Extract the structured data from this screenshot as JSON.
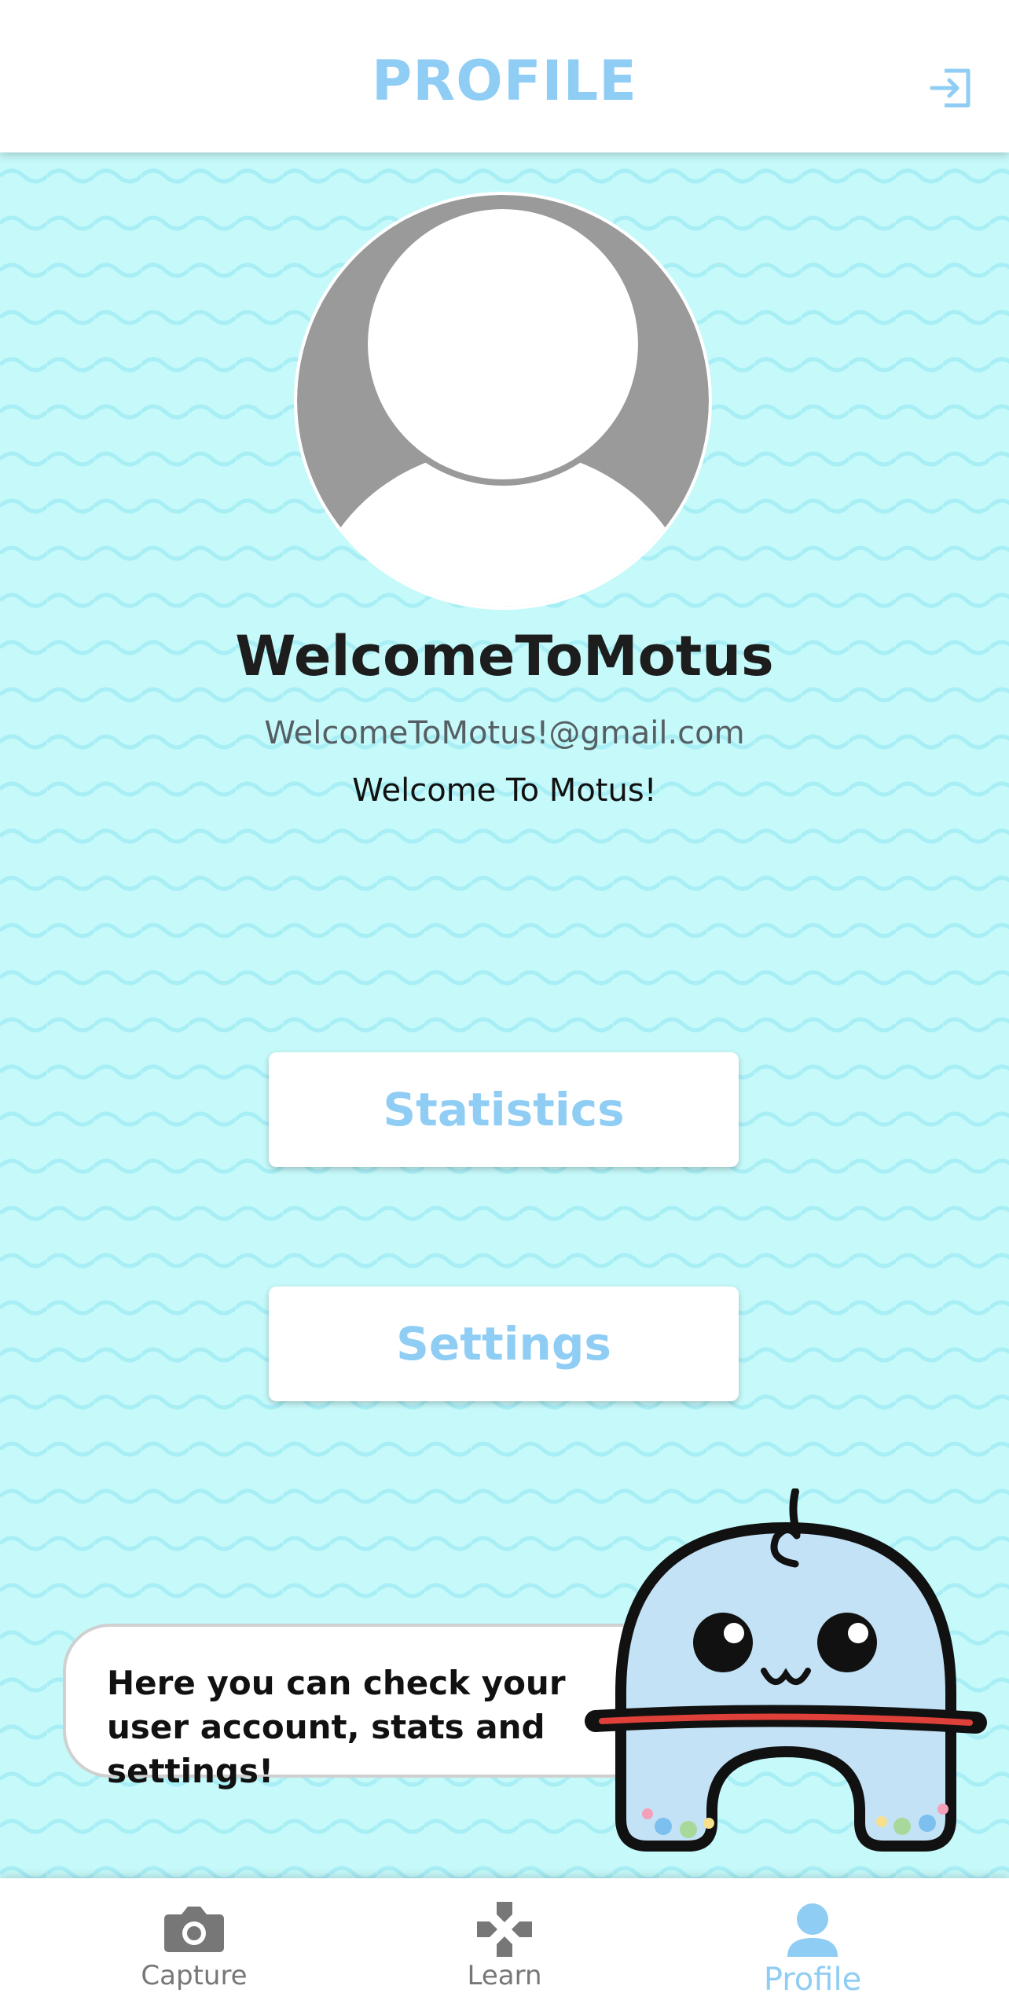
{
  "header": {
    "title": "PROFILE",
    "logout_icon": "logout-icon"
  },
  "profile": {
    "avatar_icon": "default-avatar-icon",
    "username": "WelcomeToMotus",
    "email": "WelcomeToMotus!@gmail.com",
    "bio": "Welcome To Motus!"
  },
  "actions": {
    "statistics_label": "Statistics",
    "settings_label": "Settings"
  },
  "mascot": {
    "message": "Here you can check your user account, stats and settings!"
  },
  "tabs": [
    {
      "label": "Capture",
      "icon": "camera-icon",
      "active": false
    },
    {
      "label": "Learn",
      "icon": "gamepad-icon",
      "active": false
    },
    {
      "label": "Profile",
      "icon": "person-icon",
      "active": true
    }
  ],
  "colors": {
    "accent": "#8fcdf4",
    "background": "#c6f9fa",
    "wave": "#a8eef5",
    "tab_inactive": "#777777"
  }
}
